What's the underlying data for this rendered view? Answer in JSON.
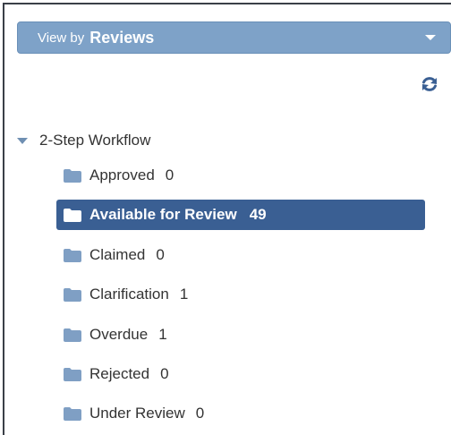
{
  "view_by": {
    "prefix": "View by",
    "value": "Reviews"
  },
  "refresh": {
    "icon": "refresh-icon"
  },
  "tree": {
    "root_label": "2-Step Workflow",
    "items": [
      {
        "label": "Approved",
        "count": "0"
      },
      {
        "label": "Available for Review",
        "count": "49",
        "selected": true
      },
      {
        "label": "Claimed",
        "count": "0"
      },
      {
        "label": "Clarification",
        "count": "1"
      },
      {
        "label": "Overdue",
        "count": "1"
      },
      {
        "label": "Rejected",
        "count": "0"
      },
      {
        "label": "Under Review",
        "count": "0"
      }
    ]
  },
  "colors": {
    "header_bg": "#7ea2c8",
    "selected_bg": "#3a5f93",
    "folder": "#7f9fc4",
    "folder_selected": "#ffffff"
  }
}
